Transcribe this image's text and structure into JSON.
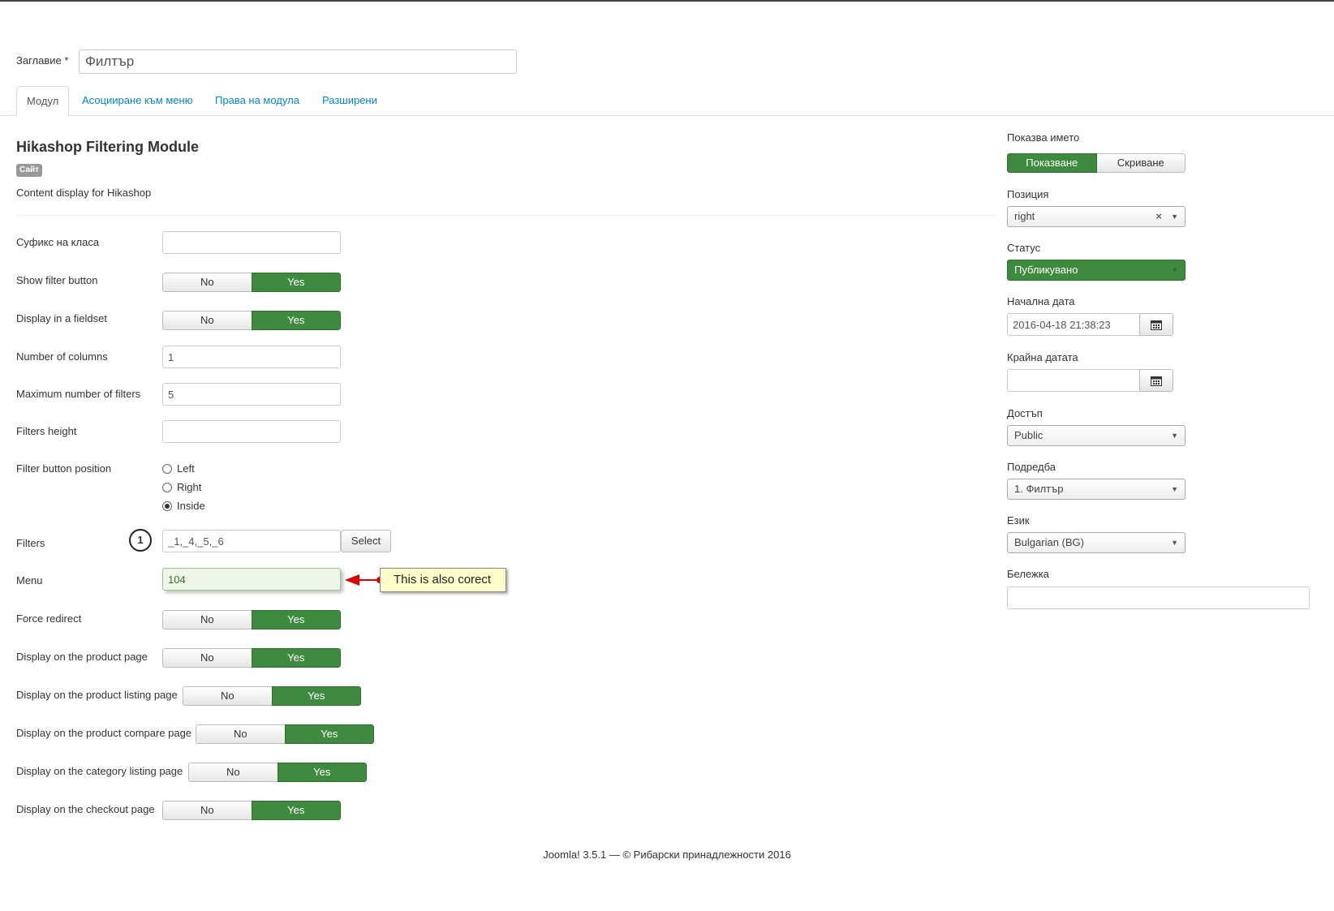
{
  "title_field": {
    "label": "Заглавие *",
    "value": "Филтър"
  },
  "tabs": [
    {
      "label": "Модул"
    },
    {
      "label": "Асоцииране към меню"
    },
    {
      "label": "Права на модула"
    },
    {
      "label": "Разширени"
    }
  ],
  "module": {
    "title": "Hikashop Filtering Module",
    "badge": "Сайт",
    "description": "Content display for Hikashop"
  },
  "form": {
    "class_suffix": {
      "label": "Суфикс на класа",
      "value": ""
    },
    "show_filter_button": {
      "label": "Show filter button",
      "no": "No",
      "yes": "Yes",
      "selected": "Yes"
    },
    "display_fieldset": {
      "label": "Display in a fieldset",
      "no": "No",
      "yes": "Yes",
      "selected": "Yes"
    },
    "num_columns": {
      "label": "Number of columns",
      "value": "1"
    },
    "max_filters": {
      "label": "Maximum number of filters",
      "value": "5"
    },
    "filters_height": {
      "label": "Filters height",
      "value": ""
    },
    "filter_button_position": {
      "label": "Filter button position",
      "options": [
        "Left",
        "Right",
        "Inside"
      ],
      "selected": "Inside"
    },
    "filters": {
      "label": "Filters",
      "value": "_1,_4,_5,_6",
      "button": "Select",
      "marker": "1"
    },
    "menu": {
      "label": "Menu",
      "value": "104"
    },
    "force_redirect": {
      "label": "Force redirect",
      "no": "No",
      "yes": "Yes",
      "selected": "Yes"
    },
    "display_product_page": {
      "label": "Display on the product page",
      "no": "No",
      "yes": "Yes",
      "selected": "Yes"
    },
    "display_product_listing": {
      "label": "Display on the product listing page",
      "no": "No",
      "yes": "Yes",
      "selected": "Yes"
    },
    "display_product_compare": {
      "label": "Display on the product compare page",
      "no": "No",
      "yes": "Yes",
      "selected": "Yes"
    },
    "display_category_listing": {
      "label": "Display on the category listing page",
      "no": "No",
      "yes": "Yes",
      "selected": "Yes"
    },
    "display_checkout": {
      "label": "Display on the checkout page",
      "no": "No",
      "yes": "Yes",
      "selected": "Yes"
    }
  },
  "annotation": {
    "text": "This is also corect"
  },
  "sidebar": {
    "show_name": {
      "label": "Показва името",
      "show": "Показване",
      "hide": "Скриване",
      "selected": "Показване"
    },
    "position": {
      "label": "Позиция",
      "value": "right"
    },
    "status": {
      "label": "Статус",
      "value": "Публикувано"
    },
    "start_date": {
      "label": "Начална дата",
      "value": "2016-04-18 21:38:23"
    },
    "end_date": {
      "label": "Крайна датата",
      "value": ""
    },
    "access": {
      "label": "Достъп",
      "value": "Public"
    },
    "ordering": {
      "label": "Подредба",
      "value": "1. Филтър"
    },
    "language": {
      "label": "Език",
      "value": "Bulgarian (BG)"
    },
    "note": {
      "label": "Бележка",
      "value": ""
    }
  },
  "footer": {
    "text": "Joomla! 3.5.1  —  © Рибарски принадлежности 2016"
  },
  "colors": {
    "accent_green": "#3e8a3e",
    "link_blue": "#0088cc",
    "note_yellow": "#ffffcc",
    "arrow_red": "#e00000"
  }
}
